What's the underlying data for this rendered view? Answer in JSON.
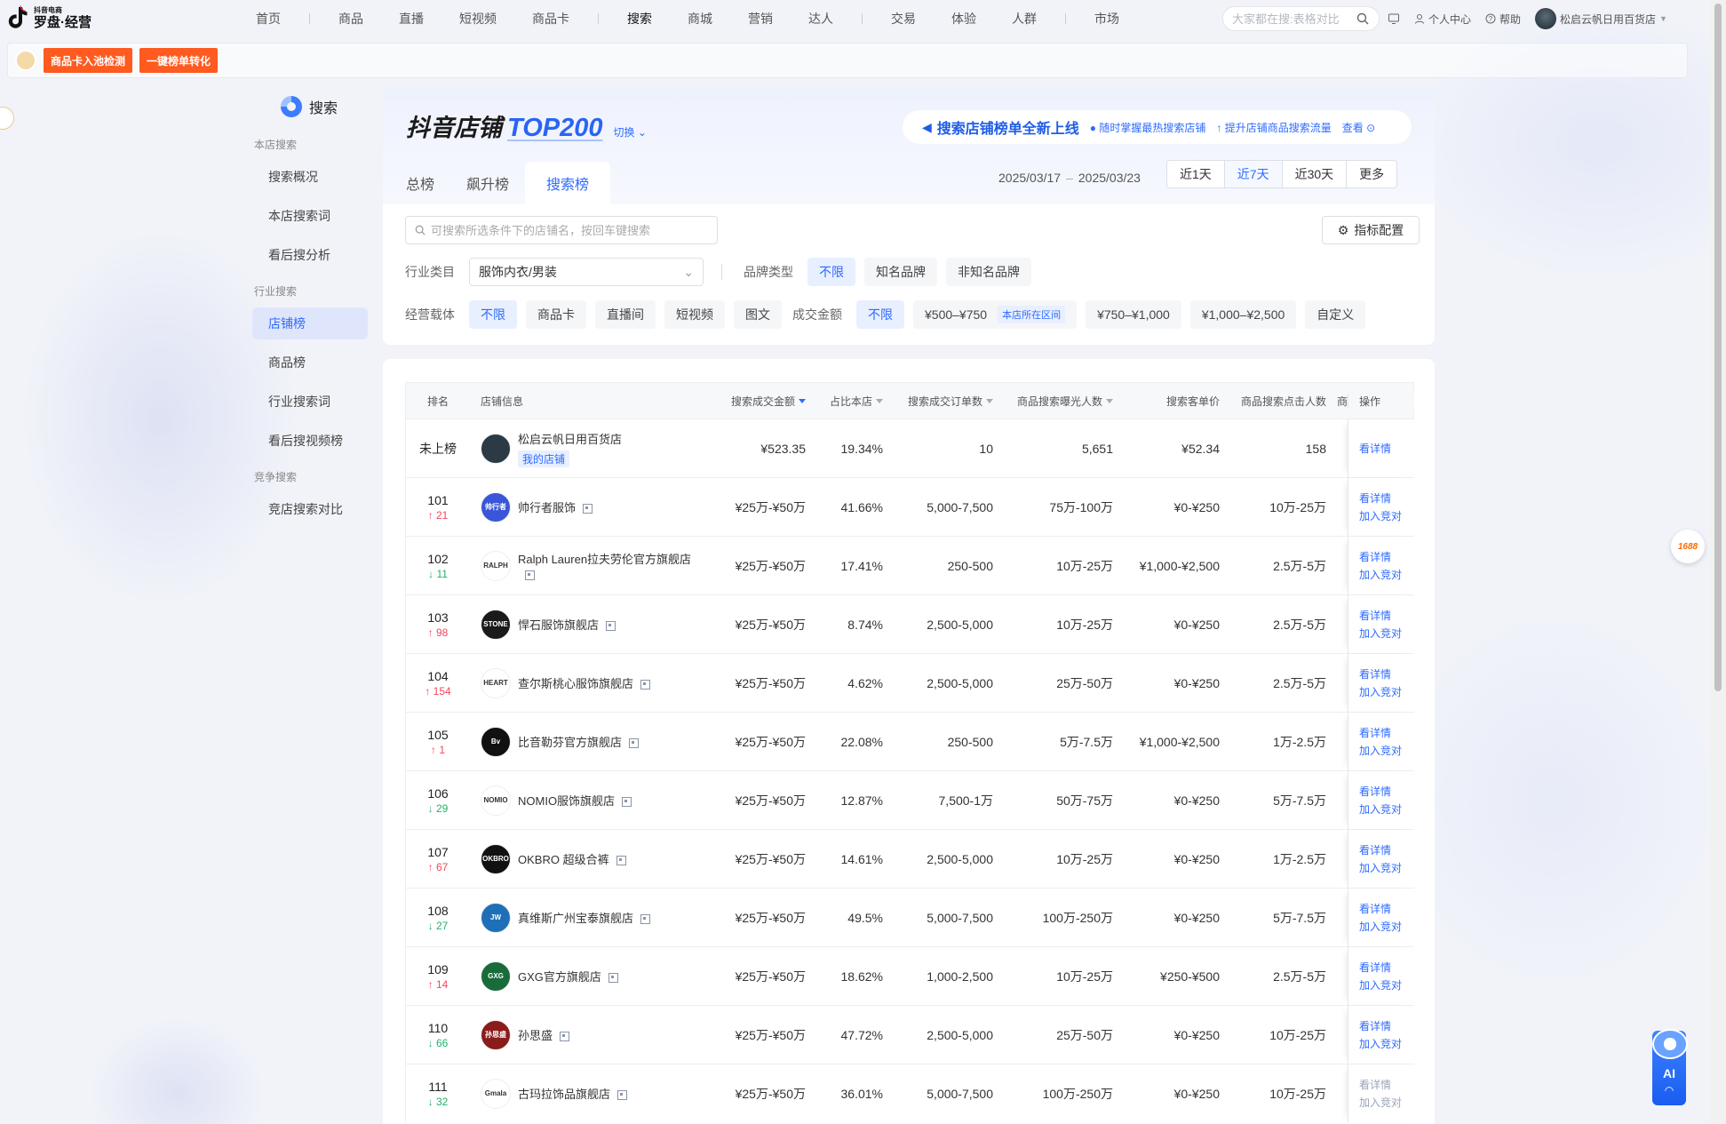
{
  "app": {
    "logo_small": "抖音电商",
    "logo_big": "罗盘·经营"
  },
  "nav": {
    "group1": [
      "首页",
      "商品",
      "直播",
      "短视频",
      "商品卡"
    ],
    "group2": [
      "搜索",
      "商城",
      "营销",
      "达人"
    ],
    "group3": [
      "交易",
      "体验",
      "人群"
    ],
    "group4": [
      "市场"
    ],
    "search_placeholder": "大家都在搜:表格对比",
    "personal_center": "个人中心",
    "help": "帮助",
    "store_name": "松启云帆日用百货店"
  },
  "banner": {
    "btn1": "商品卡入池检测",
    "btn2": "一键榜单转化"
  },
  "sidebar": {
    "title": "搜索",
    "groups": [
      {
        "label": "本店搜索",
        "items": [
          "搜索概况",
          "本店搜索词",
          "看后搜分析"
        ]
      },
      {
        "label": "行业搜索",
        "items": [
          "店铺榜",
          "商品榜",
          "行业搜索词",
          "看后搜视频榜"
        ]
      },
      {
        "label": "竞争搜索",
        "items": [
          "竞店搜索对比"
        ]
      }
    ],
    "active": "店铺榜"
  },
  "header": {
    "title_main": "抖音店铺",
    "title_accent": "TOP200",
    "switch": "切换",
    "promo_title": "搜索店铺榜单全新上线",
    "promo_sub1": "随时掌握最热搜索店铺",
    "promo_sub2": "提升店铺商品搜索流量",
    "promo_link": "查看",
    "tabs": [
      "总榜",
      "飙升榜",
      "搜索榜"
    ],
    "active_tab": "搜索榜",
    "date_start": "2025/03/17",
    "date_sep": "–",
    "date_end": "2025/03/23",
    "date_buttons": [
      "近1天",
      "近7天",
      "近30天",
      "更多"
    ],
    "active_date": "近7天"
  },
  "filters": {
    "search_placeholder": "可搜索所选条件下的店铺名，按回车键搜索",
    "metric_config": "指标配置",
    "industry_label": "行业类目",
    "industry_value": "服饰内衣/男装",
    "brand_label": "品牌类型",
    "brand_options": [
      "不限",
      "知名品牌",
      "非知名品牌"
    ],
    "carrier_label": "经营载体",
    "carrier_options": [
      "不限",
      "商品卡",
      "直播间",
      "短视频",
      "图文"
    ],
    "amount_label": "成交金额",
    "amount_options": [
      "不限",
      "¥500–¥750",
      "¥750–¥1,000",
      "¥1,000–¥2,500",
      "自定义"
    ],
    "amount_tag": "本店所在区间"
  },
  "table": {
    "columns": [
      "排名",
      "店铺信息",
      "搜索成交金额",
      "占比本店",
      "搜索成交订单数",
      "商品搜索曝光人数",
      "搜索客单价",
      "商品搜索点击人数",
      "商",
      "操作"
    ],
    "my_tag": "我的店铺",
    "link_detail": "看详情",
    "link_compare": "加入竞对",
    "rows": [
      {
        "rank": "未上榜",
        "change": "",
        "dir": "",
        "shop": "松启云帆日用百货店",
        "logo_color": "#2b3a44",
        "logo_text": "",
        "amount": "¥523.35",
        "ratio": "19.34%",
        "orders": "10",
        "exposure": "5,651",
        "price": "¥52.34",
        "clicks": "158",
        "mine": true
      },
      {
        "rank": "101",
        "change": "21",
        "dir": "up",
        "shop": "帅行者服饰",
        "logo_color": "#3a56d8",
        "logo_text": "帅行者",
        "amount": "¥25万-¥50万",
        "ratio": "41.66%",
        "orders": "5,000-7,500",
        "exposure": "75万-100万",
        "price": "¥0-¥250",
        "clicks": "10万-25万"
      },
      {
        "rank": "102",
        "change": "11",
        "dir": "down",
        "shop": "Ralph Lauren拉夫劳伦官方旗舰店",
        "logo_color": "#ffffff",
        "logo_text": "RALPH",
        "amount": "¥25万-¥50万",
        "ratio": "17.41%",
        "orders": "250-500",
        "exposure": "10万-25万",
        "price": "¥1,000-¥2,500",
        "clicks": "2.5万-5万"
      },
      {
        "rank": "103",
        "change": "98",
        "dir": "up",
        "shop": "悍石服饰旗舰店",
        "logo_color": "#1a1a1a",
        "logo_text": "STONE",
        "amount": "¥25万-¥50万",
        "ratio": "8.74%",
        "orders": "2,500-5,000",
        "exposure": "10万-25万",
        "price": "¥0-¥250",
        "clicks": "2.5万-5万"
      },
      {
        "rank": "104",
        "change": "154",
        "dir": "up",
        "shop": "查尔斯桃心服饰旗舰店",
        "logo_color": "#ffffff",
        "logo_text": "HEART",
        "amount": "¥25万-¥50万",
        "ratio": "4.62%",
        "orders": "2,500-5,000",
        "exposure": "25万-50万",
        "price": "¥0-¥250",
        "clicks": "2.5万-5万"
      },
      {
        "rank": "105",
        "change": "1",
        "dir": "up",
        "shop": "比音勒芬官方旗舰店",
        "logo_color": "#111111",
        "logo_text": "Bv",
        "amount": "¥25万-¥50万",
        "ratio": "22.08%",
        "orders": "250-500",
        "exposure": "5万-7.5万",
        "price": "¥1,000-¥2,500",
        "clicks": "1万-2.5万"
      },
      {
        "rank": "106",
        "change": "29",
        "dir": "down",
        "shop": "NOMIO服饰旗舰店",
        "logo_color": "#ffffff",
        "logo_text": "NOMIO",
        "amount": "¥25万-¥50万",
        "ratio": "12.87%",
        "orders": "7,500-1万",
        "exposure": "50万-75万",
        "price": "¥0-¥250",
        "clicks": "5万-7.5万"
      },
      {
        "rank": "107",
        "change": "67",
        "dir": "up",
        "shop": "OKBRO 超级合裤",
        "logo_color": "#111111",
        "logo_text": "OKBRO",
        "amount": "¥25万-¥50万",
        "ratio": "14.61%",
        "orders": "2,500-5,000",
        "exposure": "10万-25万",
        "price": "¥0-¥250",
        "clicks": "1万-2.5万"
      },
      {
        "rank": "108",
        "change": "27",
        "dir": "down",
        "shop": "真维斯广州宝泰旗舰店",
        "logo_color": "#1e6fb8",
        "logo_text": "JW",
        "amount": "¥25万-¥50万",
        "ratio": "49.5%",
        "orders": "5,000-7,500",
        "exposure": "100万-250万",
        "price": "¥0-¥250",
        "clicks": "5万-7.5万"
      },
      {
        "rank": "109",
        "change": "14",
        "dir": "up",
        "shop": "GXG官方旗舰店",
        "logo_color": "#1a6b3a",
        "logo_text": "GXG",
        "amount": "¥25万-¥50万",
        "ratio": "18.62%",
        "orders": "1,000-2,500",
        "exposure": "10万-25万",
        "price": "¥250-¥500",
        "clicks": "2.5万-5万"
      },
      {
        "rank": "110",
        "change": "66",
        "dir": "down",
        "shop": "孙思盛",
        "logo_color": "#8a1c1c",
        "logo_text": "孙思盛",
        "amount": "¥25万-¥50万",
        "ratio": "47.72%",
        "orders": "2,500-5,000",
        "exposure": "25万-50万",
        "price": "¥0-¥250",
        "clicks": "10万-25万"
      },
      {
        "rank": "111",
        "change": "32",
        "dir": "down",
        "shop": "古玛拉饰品旗舰店",
        "logo_color": "#ffffff",
        "logo_text": "Gmala",
        "amount": "¥25万-¥50万",
        "ratio": "36.01%",
        "orders": "5,000-7,500",
        "exposure": "100万-250万",
        "price": "¥0-¥250",
        "clicks": "10万-25万"
      }
    ]
  },
  "floats": {
    "ai_label": "AI",
    "badge_1688": "1688"
  },
  "colors": {
    "accent": "#2f6bff",
    "up": "#f5465d",
    "down": "#1fb36b",
    "banner_btn": "#ff5a1f"
  }
}
